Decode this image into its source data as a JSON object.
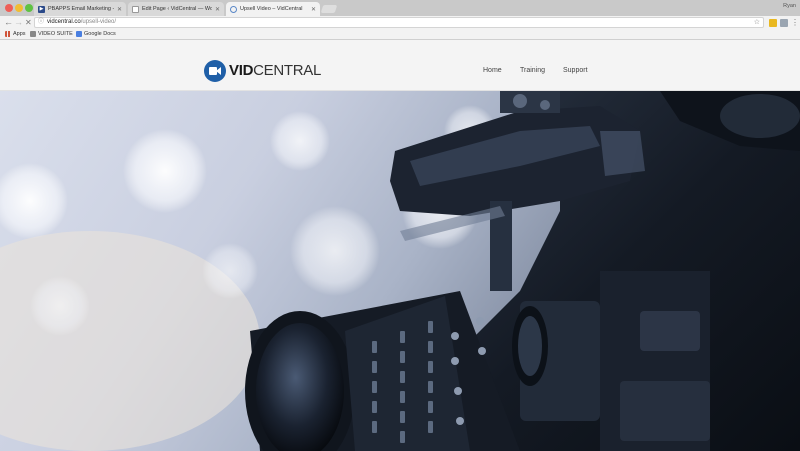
{
  "browser": {
    "tabs": [
      {
        "title": "PBAPPS Email Marketing - Clic",
        "active": false
      },
      {
        "title": "Edit Page ‹ VidCentral — Wor",
        "active": false
      },
      {
        "title": "Upsell Video – VidCentral",
        "active": true
      }
    ],
    "user_label": "Ryan",
    "url_domain": "vidcentral.co",
    "url_path": "/upsell-video/",
    "bookmarks": [
      {
        "label": "Apps",
        "icon": "apps-grid-icon"
      },
      {
        "label": "VIDEO SUITE",
        "icon": "folder-icon"
      },
      {
        "label": "Google Docs",
        "icon": "docs-icon"
      }
    ]
  },
  "site": {
    "logo_text_bold": "VID",
    "logo_text_regular": "CENTRAL",
    "nav": [
      {
        "label": "Home"
      },
      {
        "label": "Training"
      },
      {
        "label": "Support"
      }
    ]
  },
  "colors": {
    "brand_blue": "#1f5fa7",
    "header_bg": "#f4f4f4"
  },
  "hero": {
    "image_subject": "professional-video-camera"
  }
}
